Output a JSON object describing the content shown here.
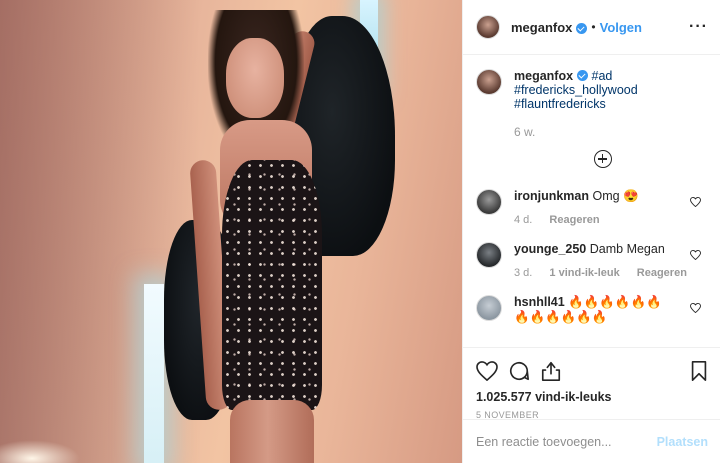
{
  "colors": {
    "accent": "#3897f0",
    "hashtag": "#003569",
    "muted": "#999999",
    "post_disabled": "#b2dffc"
  },
  "photo": {
    "alt": ""
  },
  "header": {
    "username": "meganfox",
    "verified_icon": "verified-badge-icon",
    "separator": "•",
    "follow_label": "Volgen",
    "more_label": "···"
  },
  "caption": {
    "username": "meganfox",
    "hashtags": [
      "#ad",
      "#fredericks_hollywood",
      "#flauntfredericks"
    ],
    "time": "6 w."
  },
  "load_more_icon": "plus-circle-icon",
  "comments": [
    {
      "username": "ironjunkman",
      "text": "Omg 😍",
      "time": "4 d.",
      "likes": "",
      "reply": "Reageren"
    },
    {
      "username": "younge_250",
      "text": "Damb Megan",
      "time": "3 d.",
      "likes": "1 vind-ik-leuk",
      "reply": "Reageren"
    },
    {
      "username": "hsnhll41",
      "text": "🔥🔥🔥🔥🔥🔥🔥🔥🔥🔥🔥🔥",
      "time": "",
      "likes": "",
      "reply": ""
    }
  ],
  "actions": {
    "icons": [
      "heart-icon",
      "comment-icon",
      "share-icon",
      "bookmark-icon"
    ],
    "likes": "1.025.577 vind-ik-leuks",
    "date": "5 NOVEMBER"
  },
  "add_comment": {
    "placeholder": "Een reactie toevoegen...",
    "post_label": "Plaatsen"
  }
}
